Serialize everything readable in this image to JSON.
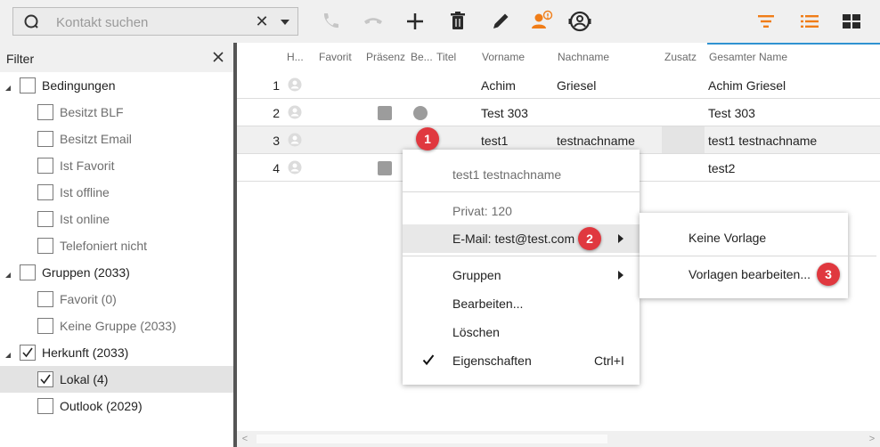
{
  "search": {
    "placeholder": "Kontakt suchen",
    "value": "",
    "clear_glyph": "✕"
  },
  "toolbar": {
    "icons": [
      "search-icon",
      "clear-icon",
      "dropdown-icon",
      "phone-icon",
      "hangup-icon",
      "add-icon",
      "delete-icon",
      "edit-icon",
      "contact-info-icon",
      "person-headset-icon",
      "filter-icon",
      "list-view-icon",
      "tile-view-icon"
    ],
    "accent_color": "#f07d18"
  },
  "filter_panel": {
    "title": "Filter",
    "items": [
      {
        "label": "Bedingungen",
        "level": 0,
        "checked": false
      },
      {
        "label": "Besitzt BLF",
        "level": 1,
        "checked": false
      },
      {
        "label": "Besitzt Email",
        "level": 1,
        "checked": false
      },
      {
        "label": "Ist Favorit",
        "level": 1,
        "checked": false
      },
      {
        "label": "Ist offline",
        "level": 1,
        "checked": false
      },
      {
        "label": "Ist online",
        "level": 1,
        "checked": false
      },
      {
        "label": "Telefoniert nicht",
        "level": 1,
        "checked": false
      },
      {
        "label": "Gruppen (2033)",
        "level": 0,
        "checked": false
      },
      {
        "label": "Favorit (0)",
        "level": 1,
        "checked": false
      },
      {
        "label": "Keine Gruppe (2033)",
        "level": 1,
        "checked": false
      },
      {
        "label": "Herkunft (2033)",
        "level": 0,
        "checked": true
      },
      {
        "label": "Lokal (4)",
        "level": 1,
        "checked": true,
        "selected": true
      },
      {
        "label": "Outlook (2029)",
        "level": 1,
        "checked": false
      }
    ]
  },
  "table": {
    "columns": [
      "H...",
      "Favorit",
      "Präsenz",
      "Be...",
      "Titel",
      "Vorname",
      "Nachname",
      "Zusatz",
      "Gesamter Name"
    ],
    "rows": [
      {
        "num": "1",
        "presence": false,
        "status": false,
        "vorname": "Achim",
        "nachname": "Griesel",
        "gesamt": "Achim Griesel"
      },
      {
        "num": "2",
        "presence": true,
        "status": true,
        "vorname": "Test 303",
        "nachname": "",
        "gesamt": "Test 303"
      },
      {
        "num": "3",
        "presence": false,
        "status": false,
        "vorname": "test1",
        "nachname": "testnachname",
        "gesamt": "test1 testnachname"
      },
      {
        "num": "4",
        "presence": true,
        "status": false,
        "vorname": "",
        "nachname": "",
        "gesamt": "test2"
      }
    ]
  },
  "context_menu": {
    "header": "test1 testnachname",
    "privat": "Privat: 120",
    "email": "E-Mail: test@test.com",
    "gruppen": "Gruppen",
    "bearbeiten": "Bearbeiten...",
    "loeschen": "Löschen",
    "eigenschaften": "Eigenschaften",
    "eigenschaften_shortcut": "Ctrl+I"
  },
  "submenu": {
    "keine_vorlage": "Keine Vorlage",
    "vorlagen_bearbeiten": "Vorlagen bearbeiten..."
  },
  "badges": [
    "1",
    "2",
    "3"
  ],
  "colors": {
    "badge": "#e0383f",
    "accent": "#f07d18",
    "sort_indicator": "#2f93d1"
  }
}
